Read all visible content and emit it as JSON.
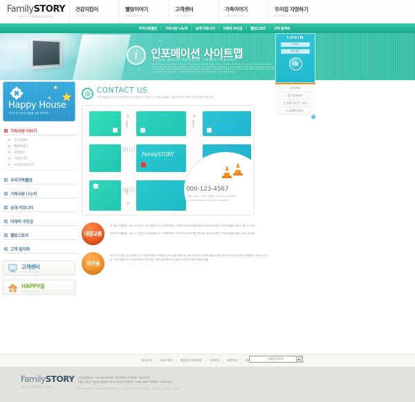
{
  "site": {
    "logo_main_a": "Family",
    "logo_main_b": "STORY",
    "logo_sub": "2004 국내 가족중심정보 포털사이트"
  },
  "topnav": [
    {
      "ko": "건강지킴이",
      "en": "LIFEHEALTH"
    },
    {
      "ko": "웰빙이야기",
      "en": "WELLBEING"
    },
    {
      "ko": "고객센터",
      "en": "CUSTOMER"
    },
    {
      "ko": "가족이야기",
      "en": "FAMILYSTORY"
    },
    {
      "ko": "우리집 자랑하기",
      "en": "SHARING HOUSE"
    }
  ],
  "greenbar": {
    "items": [
      "우리가족웰빙",
      "가족사랑 나누미",
      "공개 커뮤니티",
      "미래의 주인공",
      "웰빙스토리",
      "고객 발자취"
    ],
    "separator": "|"
  },
  "hero": {
    "icon": "information-icon",
    "icon_glyph": "i",
    "title": "인포메이션 사이트맵",
    "subtitle": "YOUR MAIN-PEOPLE FAMILYSRORY",
    "body": "CAREFUL IN YOUR DREAMAKING. ON YOUR MIND HOLDING IDEA FUTURE LIGHTING HEALTH CAREFUL IN YOUR 3 HOLDING IDEA FUTURE LIGHTING HEALT FILL MY COUNTURY HOLDING YOUR CAREFUL IN YOUR DREAMAKING. ON TO HOLDING IDEA FUTURE LIGHTING HEALT TEACHING SYSTEM BECOME IN YOUR NAVIGATION DESIGN A YOUR WEB IS COUNTURE CAREFUL. YOUR MIND HOLDING IDEA FUTURE LIGHTING HEALT"
  },
  "login": {
    "title": "LOGIN",
    "id_placeholder": "아이디",
    "pw_placeholder": "패스워드",
    "button_label": "IN"
  },
  "right_menu": [
    "HOME",
    "SITEMAP",
    "CONTACT US",
    "COMPANY"
  ],
  "sidebar": {
    "happy_house": {
      "title": "Happy House",
      "subtitle": "우리가족 건강한 생활을 위한 프로젝트"
    },
    "menu": [
      {
        "label": "가족사랑 이야기",
        "accent": "red",
        "sub": [
          "건강지킴이",
          "웰빙이야기",
          "고객센터",
          "가족이야기",
          "우리집 자랑하기"
        ]
      },
      {
        "label": "우리가족웰빙",
        "accent": "blue",
        "sub": []
      },
      {
        "label": "가족사랑 나누미",
        "accent": "blue",
        "sub": []
      },
      {
        "label": "공개 커뮤니티",
        "accent": "blue",
        "sub": []
      },
      {
        "label": "미래의 주인공",
        "accent": "blue",
        "sub": []
      },
      {
        "label": "웰빙스토리",
        "accent": "blue",
        "sub": []
      },
      {
        "label": "고객 발자취",
        "accent": "blue",
        "sub": []
      }
    ],
    "banners": [
      {
        "ko": "고객센터",
        "en": "CUSTOMER",
        "icon": "monitor-icon",
        "color": "#3c7fb1"
      },
      {
        "ko": "HAPPY몰",
        "en": "HAPPYMALL",
        "icon": "house-icon",
        "color": "#7fb83c"
      }
    ]
  },
  "content": {
    "title": "CONTACT US",
    "icon": "target-icon",
    "description": "가족사랑을 확인하신 분께 편해서 하신 상품구성 드립니다. 자세한 사항들은 개별 페이지의 가족사랑 확인중에 관한 사항",
    "map": {
      "center_label": "FamilySTORY",
      "road_labels": [
        "강남대로",
        "테헤란로",
        "논현로"
      ],
      "phone": "000-123-4567",
      "address_line1": "서울시 강서구 가양동 가양빌딩 234-340 / 15FLOOR",
      "address_line2": "Tel 02-0203-04567  /  Fax 02-203-45069"
    },
    "routes": [
      {
        "label": "대중교통",
        "style": "red",
        "paragraphs": [
          "버스를 이용할때 : 버스노선 번호 2201번을 타고 서대문역에서 하차하여 코엑스를 방향으로 내려오다보면 우측에 패밀리건물 15층 1509호",
          "지하철 이용할때 : 버스노선 번호 2201번을 타고 서대문역에서 하차하여 코엑스를 방향으로 내려오다보면 우측에 패밀리건물 15층 1509호"
        ]
      },
      {
        "label": "자가용",
        "style": "orange",
        "paragraphs": [
          "버스노선 번호 2201번을 타고 서대문역에서 하차하여 코엑스를 방향으로 내려오다보면 우측에 패밀리건물 15층 1509호 지하철 이용할때 : 버스노선 번호 2201번을 타고 서대문역에서 하차하여 코엑스를 방향으로  내려오다보면 우측에 패밀리건물"
        ]
      }
    ]
  },
  "footer": {
    "links": [
      "회사소개",
      "서비스약관",
      "개인정보 보호정책",
      "고객지원",
      "제품안내",
      "광고문의",
      "인재모집"
    ],
    "separator": "|",
    "family_select": "패밀리사이트",
    "logo_a": "Family",
    "logo_b": "STORY",
    "logo_sub": "2004 국내 가족중심정보 포털사이트",
    "info_line1": "사업자등록번호 : 200-405-394857   통신판매업 신고번호 : 제905784",
    "info_line2": "서울시 강남구 강남동 강남빌딩 34-90  인락명 관한문의 : 1588-8888 전화문의 : 1588-888",
    "copyright": "COPYRIGHT FAMILYSTORY ALL RIGHT RESERVED. SINCE 1900 2004"
  }
}
